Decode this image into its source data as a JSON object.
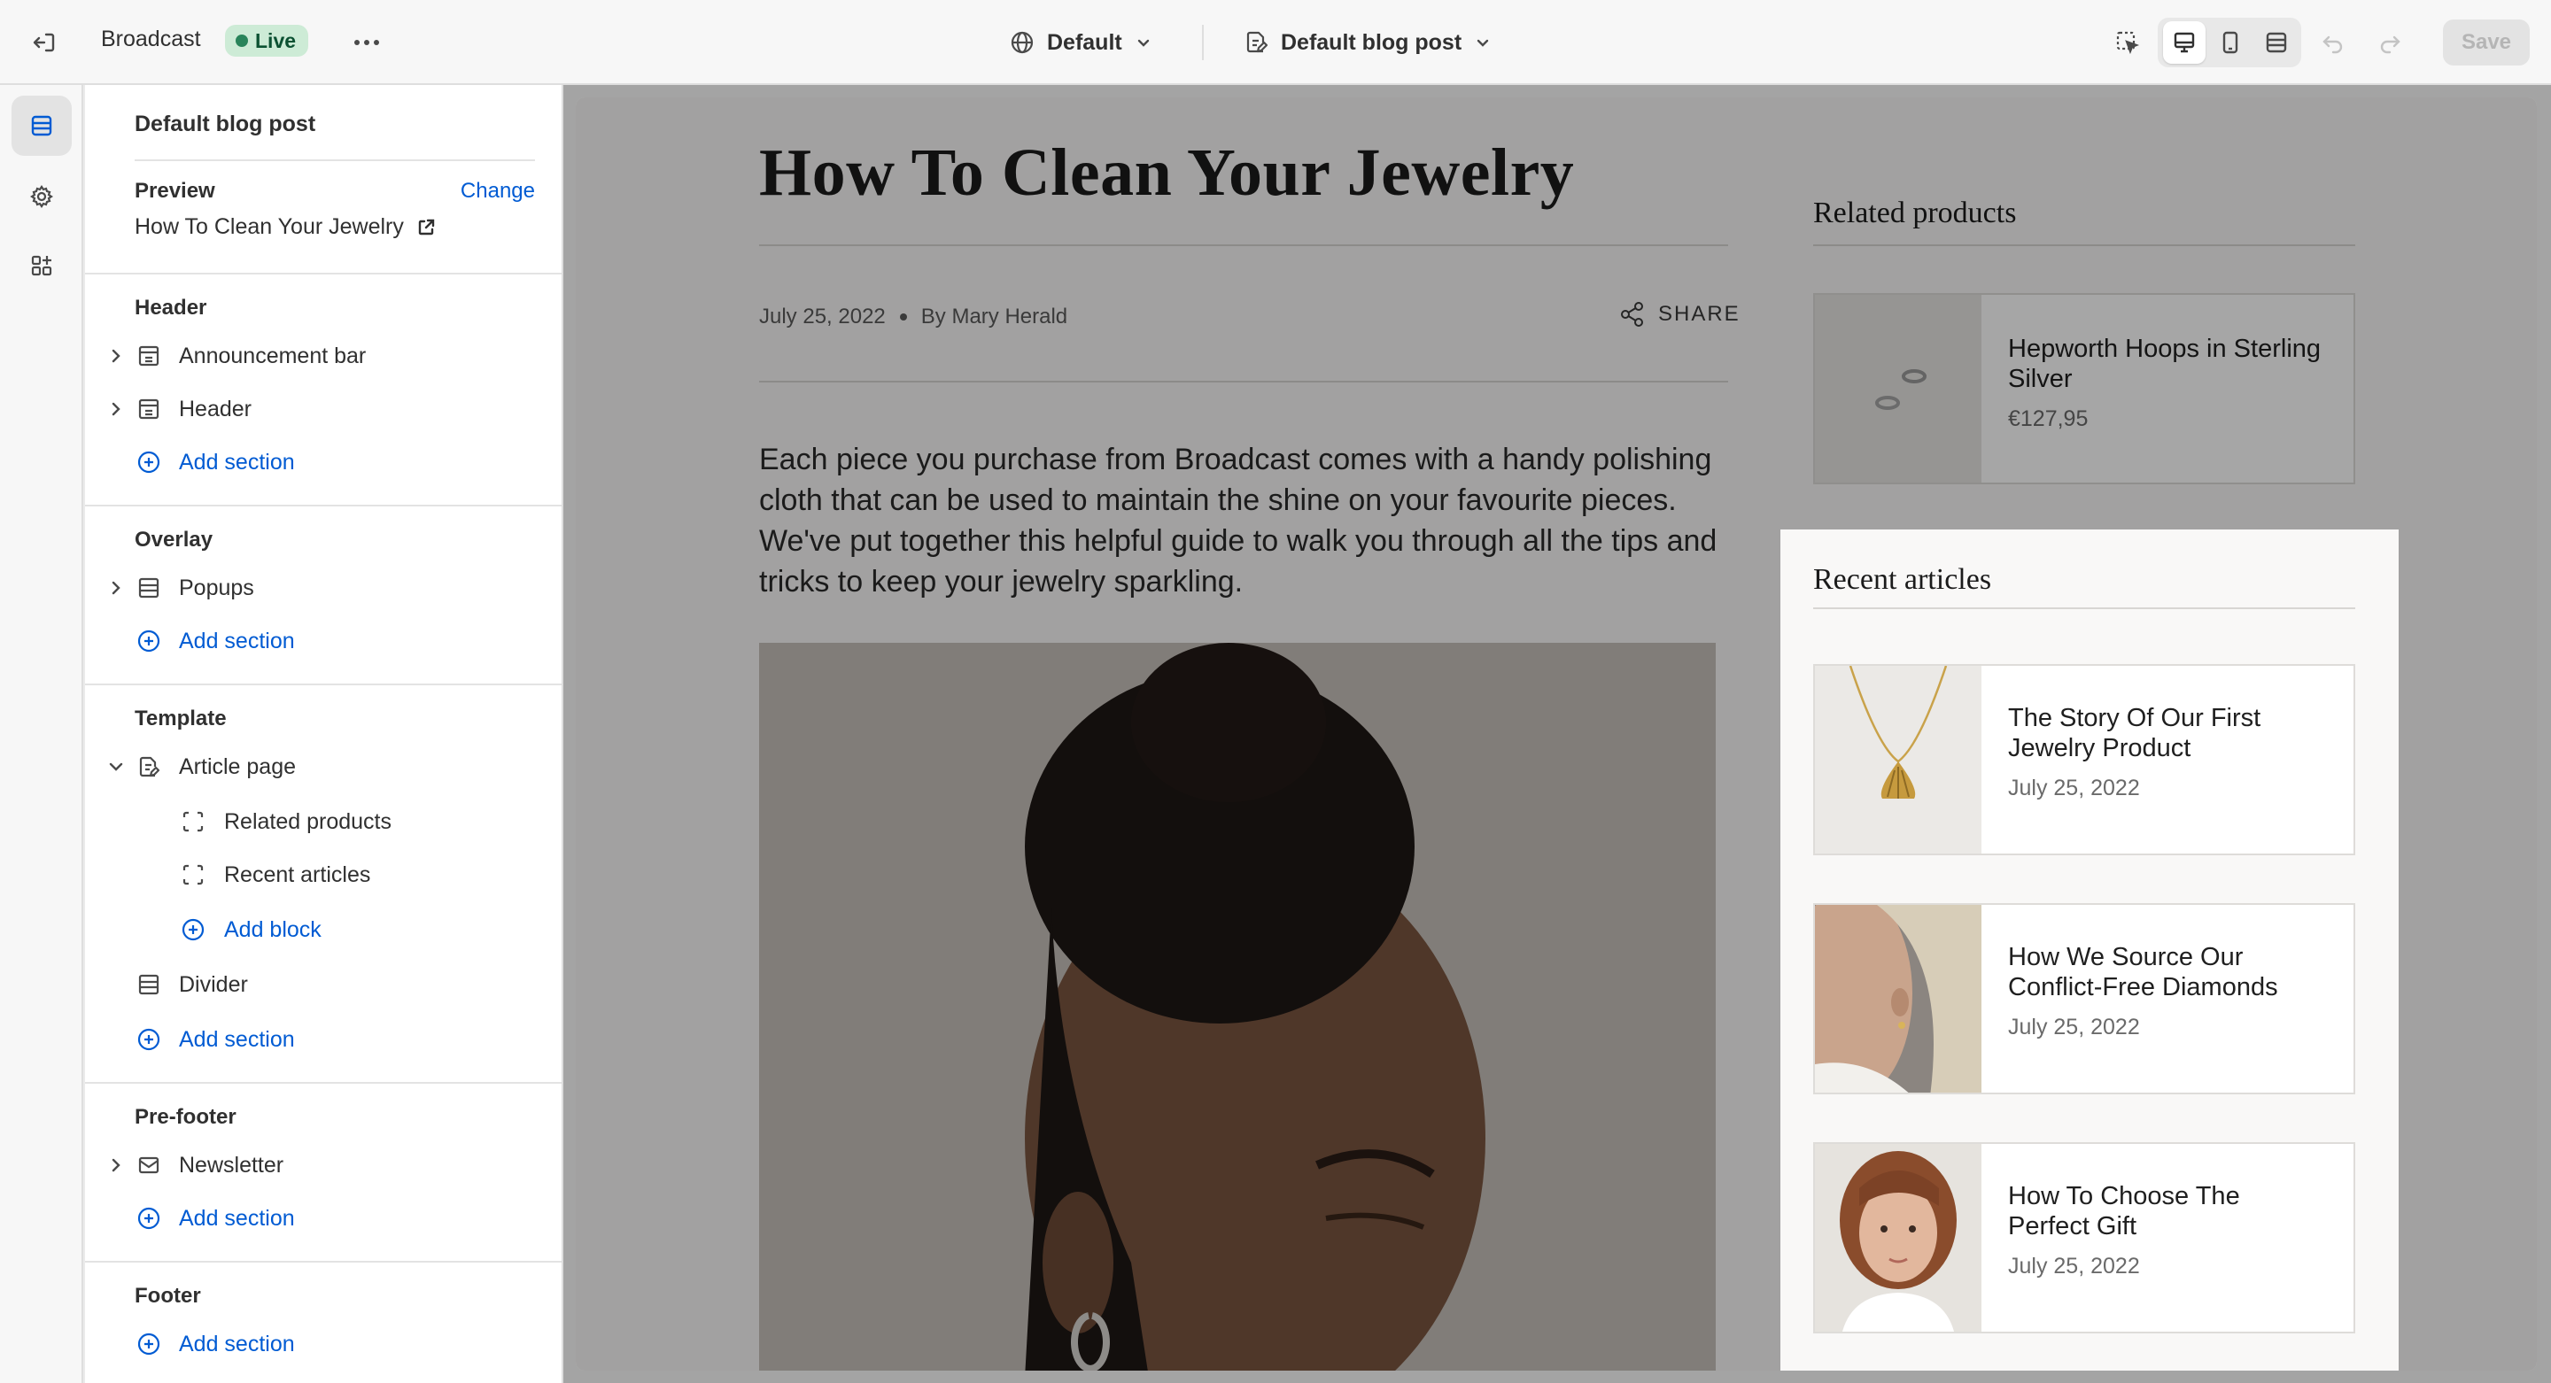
{
  "topbar": {
    "store_name": "Broadcast",
    "status_badge": "Live",
    "theme_selector": "Default",
    "template_selector": "Default blog post",
    "save_label": "Save"
  },
  "rail": {
    "items": [
      "sections-icon",
      "gear-icon",
      "apps-icon"
    ]
  },
  "sidebar": {
    "title": "Default blog post",
    "preview_label": "Preview",
    "change_link": "Change",
    "preview_value": "How To Clean Your Jewelry",
    "groups": {
      "header": {
        "label": "Header",
        "items": [
          "Announcement bar",
          "Header"
        ],
        "add": "Add section"
      },
      "overlay": {
        "label": "Overlay",
        "items": [
          "Popups"
        ],
        "add": "Add section"
      },
      "template": {
        "label": "Template",
        "article_page": "Article page",
        "blocks": [
          "Related products",
          "Recent articles"
        ],
        "add_block": "Add block",
        "divider": "Divider",
        "add": "Add section"
      },
      "prefooter": {
        "label": "Pre-footer",
        "items": [
          "Newsletter"
        ],
        "add": "Add section"
      },
      "footer": {
        "label": "Footer",
        "add": "Add section"
      }
    }
  },
  "article": {
    "title": "How To Clean Your Jewelry",
    "date": "July 25, 2022",
    "author": "By Mary Herald",
    "share": "SHARE",
    "lead": "Each piece you purchase from Broadcast comes with a handy polishing cloth that can be used to maintain the shine on your favourite pieces. We've put together this helpful guide to walk you through all the tips and tricks to keep your jewelry sparkling."
  },
  "related": {
    "title": "Related products",
    "products": [
      {
        "name": "Hepworth Hoops in Sterling Silver",
        "price": "€127,95"
      }
    ]
  },
  "recent": {
    "title": "Recent articles",
    "articles": [
      {
        "title": "The Story Of Our First Jewelry Product",
        "date": "July 25, 2022"
      },
      {
        "title": "How We Source Our Conflict-Free Diamonds",
        "date": "July 25, 2022"
      },
      {
        "title": "How To Choose The Perfect Gift",
        "date": "July 25, 2022"
      }
    ]
  }
}
